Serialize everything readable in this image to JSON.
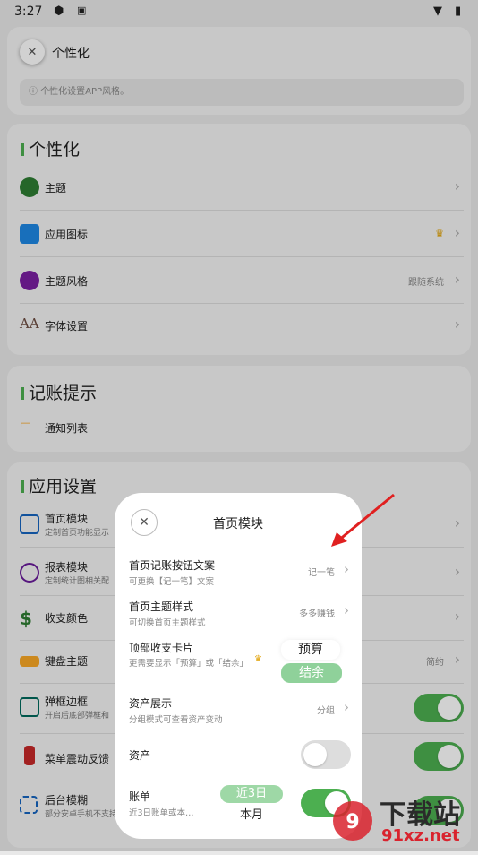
{
  "status_bar": {
    "time": "3:27"
  },
  "header": {
    "title": "个性化",
    "info": "个性化设置APP风格。"
  },
  "sections": {
    "personalization": {
      "title": "个性化",
      "items": [
        {
          "label": "主题",
          "value": ""
        },
        {
          "label": "应用图标",
          "value": ""
        },
        {
          "label": "主题风格",
          "value": "跟随系统"
        },
        {
          "label": "字体设置",
          "value": ""
        }
      ]
    },
    "reminders": {
      "title": "记账提示",
      "items": [
        {
          "label": "通知列表"
        }
      ]
    },
    "app_settings": {
      "title": "应用设置",
      "items": [
        {
          "label": "首页模块",
          "sub": "定制首页功能显示"
        },
        {
          "label": "报表模块",
          "sub": "定制统计图相关配"
        },
        {
          "label": "收支颜色",
          "sub": ""
        },
        {
          "label": "键盘主题",
          "sub": "",
          "value": "简约"
        },
        {
          "label": "弹框边框",
          "sub": "开启后底部弹框和"
        },
        {
          "label": "菜单震动反馈",
          "sub": ""
        },
        {
          "label": "后台模糊",
          "sub": "部分安卓手机不支持"
        }
      ]
    }
  },
  "dialog": {
    "title": "首页模块",
    "rows": [
      {
        "title": "首页记账按钮文案",
        "sub": "可更换【记一笔】文案",
        "value": "记一笔"
      },
      {
        "title": "首页主题样式",
        "sub": "可切换首页主题样式",
        "value": "多多赚钱"
      },
      {
        "title": "顶部收支卡片",
        "sub": "更需要显示「预算」或「结余」"
      },
      {
        "title": "资产展示",
        "sub": "分组模式可查看资产变动",
        "value": "分组"
      },
      {
        "title": "资产",
        "sub": ""
      },
      {
        "title": "账单",
        "sub": "近3日账单或本…"
      }
    ],
    "card_options": [
      "预算",
      "结余"
    ],
    "bill_options": [
      "近3日",
      "本月"
    ]
  },
  "watermark": {
    "brand": "下载站",
    "domain": "91xz.net"
  },
  "colors": {
    "accent": "#4caf50",
    "background": "#e9e9e9",
    "card": "#f4f4f4"
  }
}
